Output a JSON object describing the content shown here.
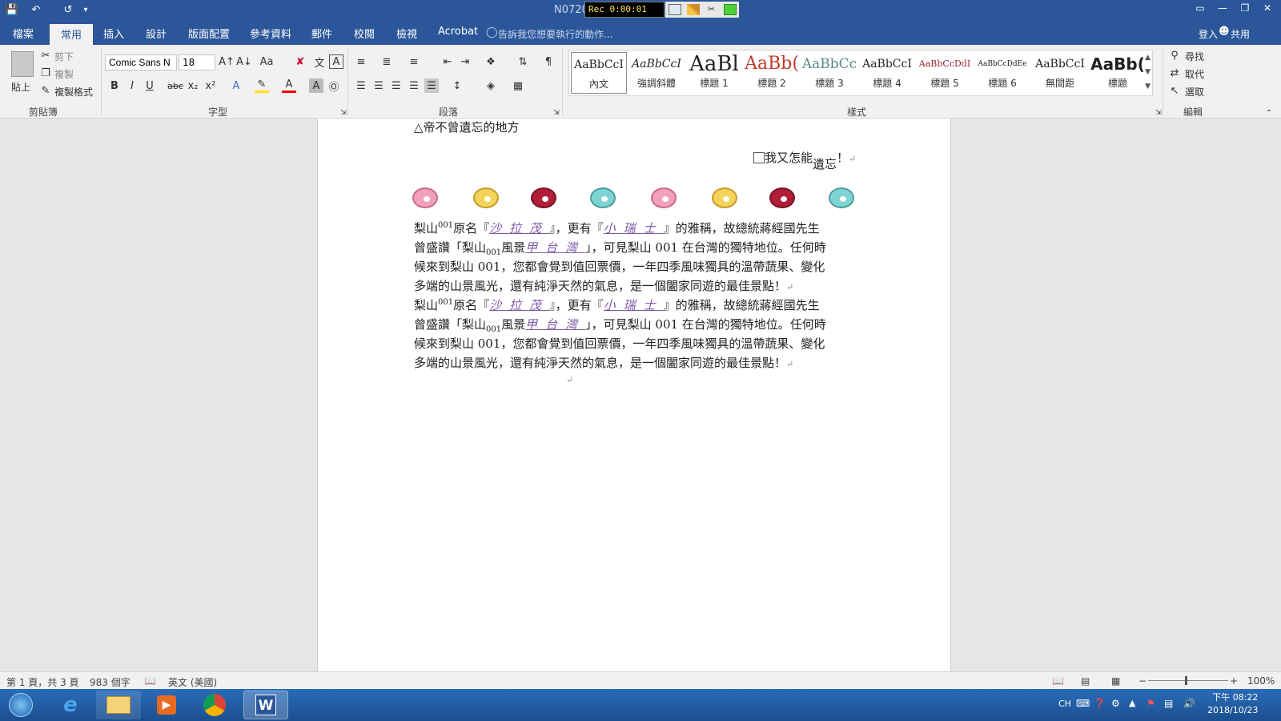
{
  "titlebar": {
    "doc_title": "N0720",
    "rec_text": "Rec 0:00:01"
  },
  "tabs": [
    {
      "label": "檔案"
    },
    {
      "label": "常用"
    },
    {
      "label": "插入"
    },
    {
      "label": "設計"
    },
    {
      "label": "版面配置"
    },
    {
      "label": "參考資料"
    },
    {
      "label": "郵件"
    },
    {
      "label": "校閱"
    },
    {
      "label": "檢視"
    },
    {
      "label": "Acrobat"
    }
  ],
  "tellme": "告訴我您想要執行的動作...",
  "signin": "登入",
  "share": "共用",
  "clipboard": {
    "paste": "貼上",
    "cut": "剪下",
    "copy": "複製",
    "format_painter": "複製格式",
    "label": "剪貼簿"
  },
  "font": {
    "name": "Comic Sans N",
    "size": "18",
    "label": "字型"
  },
  "paragraph": {
    "label": "段落"
  },
  "styles": {
    "label": "樣式",
    "items": [
      {
        "sample": "AaBbCcI",
        "name": "內文"
      },
      {
        "sample": "AaBbCcI",
        "name": "強調斜體"
      },
      {
        "sample": "AaBl",
        "name": "標題 1"
      },
      {
        "sample": "AaBb(",
        "name": "標題 2"
      },
      {
        "sample": "AaBbCc",
        "name": "標題 3"
      },
      {
        "sample": "AaBbCcI",
        "name": "標題 4"
      },
      {
        "sample": "AaBbCcDdI",
        "name": "標題 5"
      },
      {
        "sample": "AaBbCcDdEe",
        "name": "標題 6"
      },
      {
        "sample": "AaBbCcI",
        "name": "無間距"
      },
      {
        "sample": "AaBb(",
        "name": "標題"
      }
    ]
  },
  "editing": {
    "find": "尋找",
    "replace": "取代",
    "select": "選取",
    "label": "編輯"
  },
  "document": {
    "line_top": "△帝不曾遺忘的地方",
    "line_right_a": "我又怎能",
    "line_right_b": "遺忘",
    "line_right_c": "！",
    "p_a1": "梨山",
    "p_sup": "001",
    "p_a2": "原名『",
    "p_link1": "沙拉茂",
    "p_a3": "』，更有『",
    "p_link2": "小瑞士",
    "p_a4": "』的雅稱，故總統蔣經國先生",
    "p_b1": "曾盛讚「梨山",
    "p_sub": "001",
    "p_b2": "風景",
    "p_link3": "甲台灣",
    "p_b3": "」，可見梨山 001 在台灣的獨特地位。任何時",
    "p_c": "候來到梨山 001，您都會覺到值回票價，一年四季風味獨具的溫帶蔬果、變化",
    "p_d": "多端的山景風光，還有純淨天然的氣息，是一個闔家同遊的最佳景點！"
  },
  "status": {
    "page": "第 1 頁，共 3 頁",
    "words": "983 個字",
    "language": "英文 (美國)",
    "zoom": "100%"
  },
  "tray": {
    "lang": "CH",
    "time": "下午 08:22",
    "date": "2018/10/23"
  },
  "colors": {
    "ribbon_blue": "#2b579a",
    "link_purple": "#7b5aa6"
  }
}
